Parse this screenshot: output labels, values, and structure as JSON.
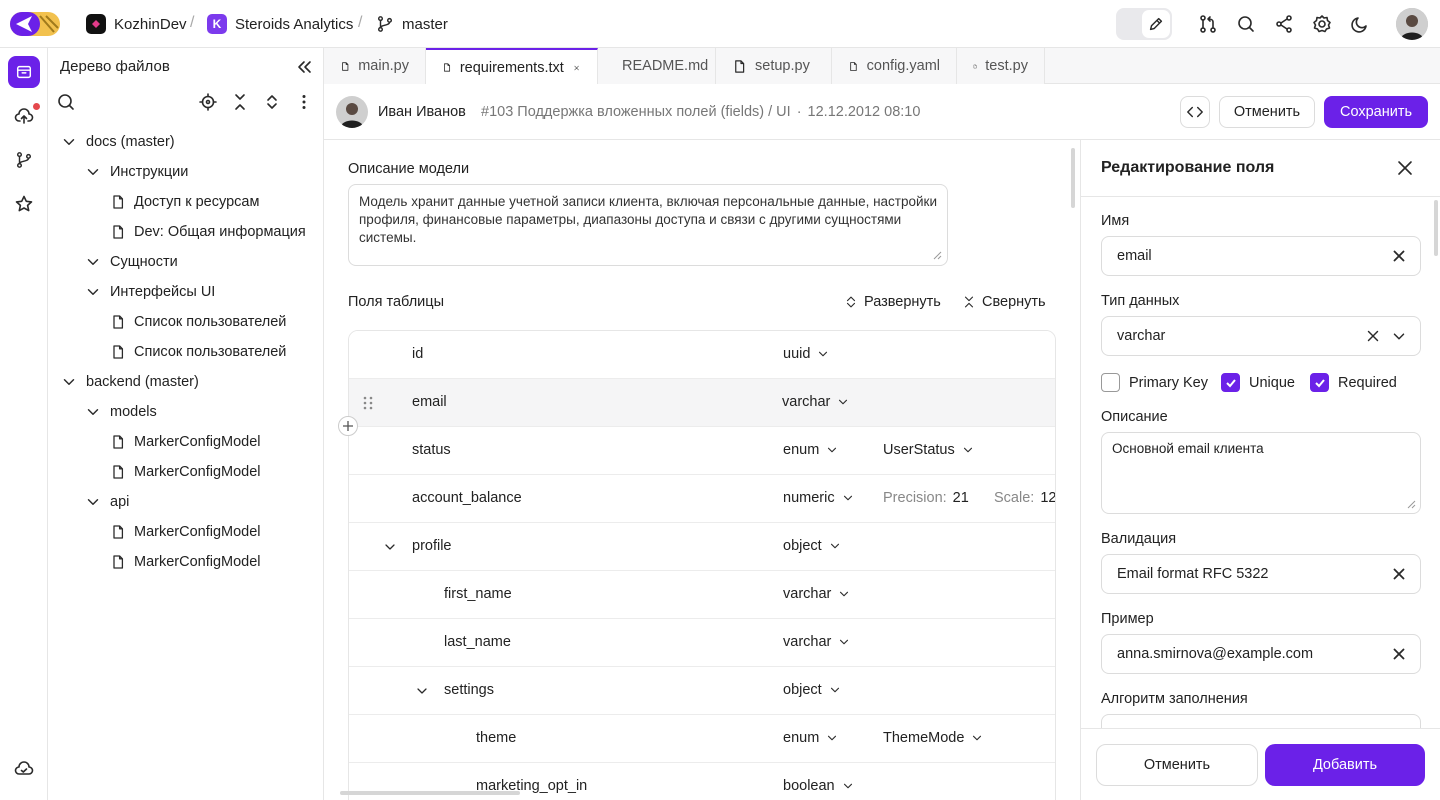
{
  "topbar": {
    "workspace": "KozhinDev",
    "project_initial": "K",
    "project": "Steroids Analytics",
    "branch": "master",
    "separator": "/"
  },
  "tree": {
    "title": "Дерево файлов",
    "items": [
      {
        "label": "docs (master)",
        "type": "folder",
        "level": 0
      },
      {
        "label": "Инструкции",
        "type": "folder",
        "level": 1
      },
      {
        "label": "Доступ к ресурсам",
        "type": "file",
        "level": 2
      },
      {
        "label": "Dev: Общая информация",
        "type": "file",
        "level": 2
      },
      {
        "label": "Сущности",
        "type": "folder",
        "level": 1
      },
      {
        "label": "Интерфейсы UI",
        "type": "folder",
        "level": 1
      },
      {
        "label": "Список пользователей",
        "type": "file",
        "level": 2
      },
      {
        "label": "Список пользователей",
        "type": "file",
        "level": 2
      },
      {
        "label": "backend (master)",
        "type": "folder",
        "level": 0
      },
      {
        "label": "models",
        "type": "folder",
        "level": 1
      },
      {
        "label": "MarkerConfigModel",
        "type": "file",
        "level": 2
      },
      {
        "label": "MarkerConfigModel",
        "type": "file",
        "level": 2
      },
      {
        "label": "api",
        "type": "folder",
        "level": 1
      },
      {
        "label": "MarkerConfigModel",
        "type": "file",
        "level": 2
      },
      {
        "label": "MarkerConfigModel",
        "type": "file",
        "level": 2
      }
    ]
  },
  "tabs": [
    {
      "label": "main.py",
      "active": false
    },
    {
      "label": "requirements.txt",
      "active": true
    },
    {
      "label": "README.md",
      "active": false
    },
    {
      "label": "setup.py",
      "active": false
    },
    {
      "label": "config.yaml",
      "active": false
    },
    {
      "label": "test.py",
      "active": false
    }
  ],
  "commit": {
    "author": "Иван Иванов",
    "title": "#103 Поддержка вложенных полей (fields) / UI",
    "dot": "·",
    "date": "12.12.2012 08:10",
    "cancel_label": "Отменить",
    "save_label": "Сохранить"
  },
  "main": {
    "description_label": "Описание модели",
    "description": "Модель хранит данные учетной записи клиента, включая персональные данные, настройки профиля, финансовые параметры, диапазоны доступа и связи с другими сущностями системы.",
    "fields_label": "Поля таблицы",
    "expand_label": "Развернуть",
    "collapse_label": "Свернуть",
    "precision_label": "Precision:",
    "scale_label": "Scale:",
    "fields": [
      {
        "name": "id",
        "type": "uuid",
        "level": 0
      },
      {
        "name": "email",
        "type": "varchar",
        "level": 0,
        "selected": true
      },
      {
        "name": "status",
        "type": "enum",
        "enum": "UserStatus",
        "level": 0
      },
      {
        "name": "account_balance",
        "type": "numeric",
        "precision": "21",
        "scale": "12",
        "level": 0
      },
      {
        "name": "profile",
        "type": "object",
        "level": 0,
        "expanded": true
      },
      {
        "name": "first_name",
        "type": "varchar",
        "level": 1
      },
      {
        "name": "last_name",
        "type": "varchar",
        "level": 1
      },
      {
        "name": "settings",
        "type": "object",
        "level": 1,
        "expanded": true
      },
      {
        "name": "theme",
        "type": "enum",
        "enum": "ThemeMode",
        "level": 2
      },
      {
        "name": "marketing_opt_in",
        "type": "boolean",
        "level": 2
      }
    ]
  },
  "panel": {
    "title": "Редактирование поля",
    "name_label": "Имя",
    "name_value": "email",
    "type_label": "Тип данных",
    "type_value": "varchar",
    "primary_key_label": "Primary Key",
    "primary_key": false,
    "unique_label": "Unique",
    "unique": true,
    "required_label": "Required",
    "required": true,
    "description_label": "Описание",
    "description_value": "Основной email клиента",
    "validation_label": "Валидация",
    "validation_value": "Email format RFC 5322",
    "example_label": "Пример",
    "example_value": "anna.smirnova@example.com",
    "fill_label": "Алгоритм заполнения",
    "cancel_label": "Отменить",
    "add_label": "Добавить"
  },
  "colors": {
    "accent": "#6b21e8",
    "workspace_logo": "#111111",
    "project_logo": "#7c3aed"
  }
}
